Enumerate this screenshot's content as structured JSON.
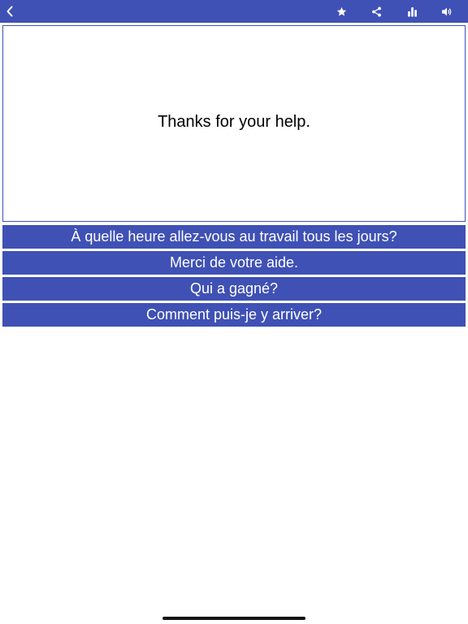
{
  "toolbar": {
    "icons": {
      "back": "chevron-left-icon",
      "favorite": "star-icon",
      "share": "share-icon",
      "stats": "bar-chart-icon",
      "sound": "speaker-icon"
    }
  },
  "question": {
    "text": "Thanks for your help."
  },
  "options": [
    {
      "label": "À quelle heure allez-vous au travail tous les jours?"
    },
    {
      "label": "Merci de votre aide."
    },
    {
      "label": "Qui a gagné?"
    },
    {
      "label": "Comment puis-je y arriver?"
    }
  ],
  "colors": {
    "primary": "#3f51b5",
    "background": "#ffffff",
    "text": "#000000",
    "option_text": "#ffffff"
  }
}
